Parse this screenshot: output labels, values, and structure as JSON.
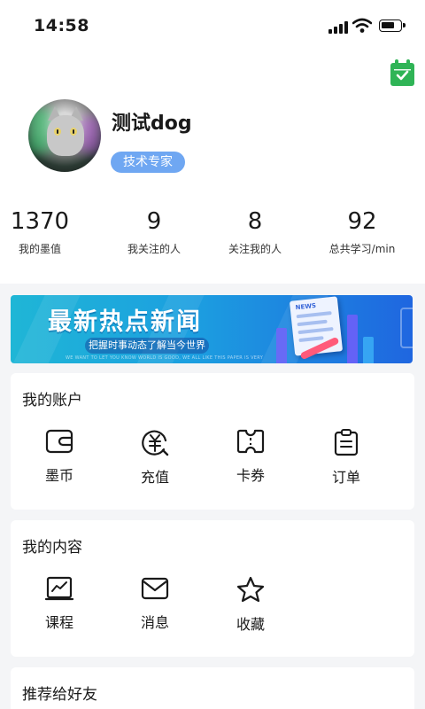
{
  "status_bar": {
    "time": "14:58"
  },
  "profile": {
    "username": "测试dog",
    "badge": "技术专家"
  },
  "stats": [
    {
      "value": "1370",
      "label": "我的墨值"
    },
    {
      "value": "9",
      "label": "我关注的人"
    },
    {
      "value": "8",
      "label": "关注我的人"
    },
    {
      "value": "92",
      "label": "总共学习/min"
    }
  ],
  "banner": {
    "title": "最新热点新闻",
    "subtitle": "把握时事动态了解当今世界",
    "tiny_text": "WE WANT TO LET YOU KNOW WORLD IS GOOD, WE ALL LIKE THIS PAPER IS VERY",
    "paper_label": "NEWS"
  },
  "account_section": {
    "title": "我的账户",
    "items": [
      {
        "label": "墨币",
        "icon": "wallet-icon"
      },
      {
        "label": "充值",
        "icon": "yuan-coin-icon"
      },
      {
        "label": "卡券",
        "icon": "ticket-icon"
      },
      {
        "label": "订单",
        "icon": "clipboard-icon"
      }
    ]
  },
  "content_section": {
    "title": "我的内容",
    "items": [
      {
        "label": "课程",
        "icon": "chart-course-icon"
      },
      {
        "label": "消息",
        "icon": "envelope-icon"
      },
      {
        "label": "收藏",
        "icon": "star-icon"
      }
    ]
  },
  "recommend_section": {
    "title": "推荐给好友"
  },
  "colors": {
    "accent_green": "#2fb456",
    "badge_blue": "#6fa7f2",
    "page_bg": "#f4f5f7"
  }
}
